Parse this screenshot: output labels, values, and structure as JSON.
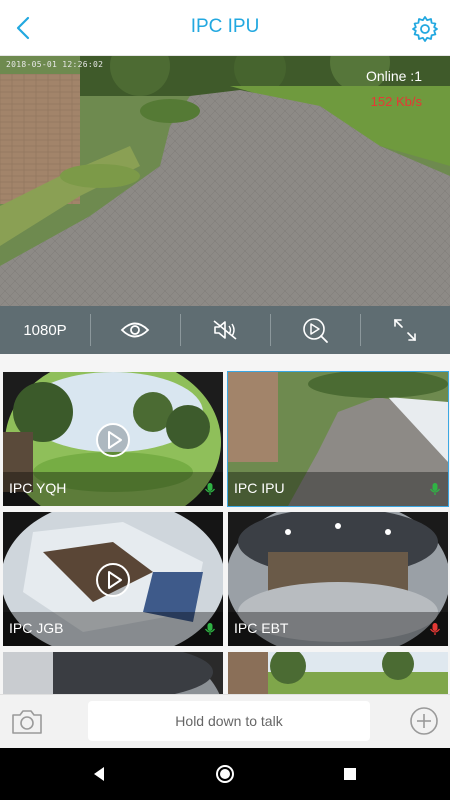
{
  "header": {
    "title": "IPC IPU"
  },
  "live": {
    "timestamp": "2018-05-01 12:26:02",
    "online": "Online :1",
    "rate": "152 Kb/s"
  },
  "controls": {
    "resolution": "1080P"
  },
  "cameras": [
    {
      "name": "IPC YQH",
      "mic_color": "#2fb344"
    },
    {
      "name": "IPC IPU",
      "mic_color": "#2fb344"
    },
    {
      "name": "IPC JGB",
      "mic_color": "#2fb344"
    },
    {
      "name": "IPC EBT",
      "mic_color": "#e53935"
    }
  ],
  "toolbar": {
    "talk_label": "Hold down to talk"
  },
  "colors": {
    "accent": "#22a8e0",
    "control_bar": "#5f6d72",
    "online": "#ffffff",
    "rate": "#e53935"
  }
}
